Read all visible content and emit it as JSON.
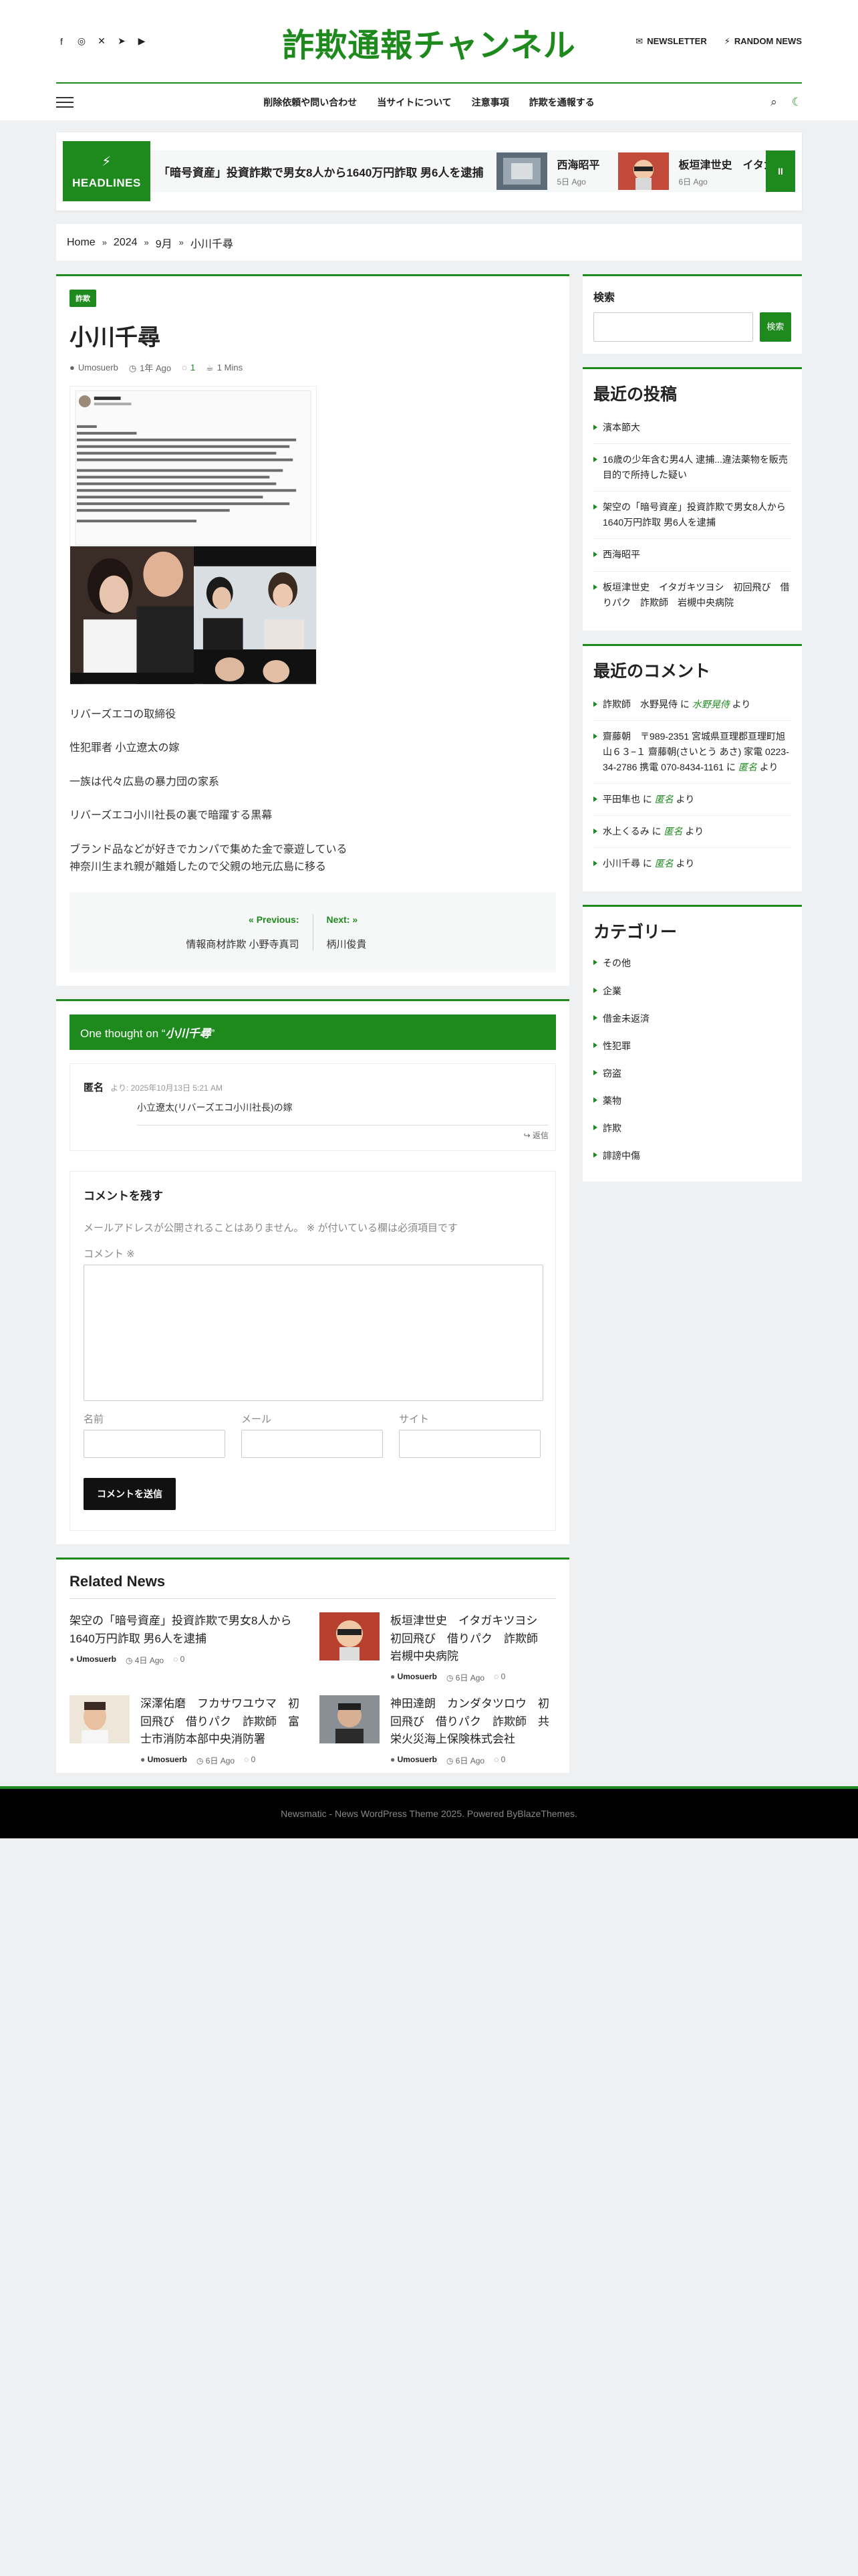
{
  "site": {
    "title": "詐欺通報チャンネル",
    "newsletter": "NEWSLETTER",
    "random": "RANDOM NEWS"
  },
  "menu": [
    "削除依頼や問い合わせ",
    "当サイトについて",
    "注意事項",
    "詐欺を通報する"
  ],
  "ticker": {
    "label": "HEADLINES",
    "lead": "「暗号資産」投資詐欺で男女8人から1640万円詐取 男6人を逮捕",
    "items": [
      {
        "title": "西海昭平",
        "date": "5日 Ago"
      },
      {
        "title": "板垣津世史　イタガ",
        "date": "6日 Ago"
      }
    ],
    "pause": "II"
  },
  "breadcrumb": [
    "Home",
    "2024",
    "9月",
    "小川千尋"
  ],
  "post": {
    "category": "詐欺",
    "title": "小川千尋",
    "author": "Umosuerb",
    "date": "1年 Ago",
    "comments": "1",
    "read": "1 Mins",
    "paragraphs": [
      "リバーズエコの取締役",
      "性犯罪者 小立遼太の嫁",
      "一族は代々広島の暴力団の家系",
      "リバーズエコ小川社長の裏で暗躍する黒幕",
      "ブランド品などが好きでカンパで集めた金で豪遊している\n神奈川生まれ親が離婚したので父親の地元広島に移る"
    ],
    "prev_label": "Previous:",
    "prev_title": "情報商材詐欺 小野寺真司",
    "next_label": "Next:",
    "next_title": "柄川俊貴"
  },
  "comments": {
    "heading_prefix": "One thought on “",
    "heading_title": "小川千尋",
    "heading_suffix": "”",
    "author": "匿名",
    "date": "より: 2025年10月13日 5:21 AM",
    "text": "小立遼太(リバーズエコ小川社長)の嫁",
    "reply": "返信"
  },
  "form": {
    "title": "コメントを残す",
    "note": "メールアドレスが公開されることはありません。 ※ が付いている欄は必須項目です",
    "comment_label": "コメント ※",
    "name_label": "名前",
    "email_label": "メール",
    "site_label": "サイト",
    "submit": "コメントを送信"
  },
  "related": {
    "title": "Related News",
    "items": [
      {
        "title": "架空の「暗号資産」投資詐欺で男女8人から1640万円詐取 男6人を逮捕",
        "author": "Umosuerb",
        "date": "4日 Ago",
        "comments": "0",
        "thumb": false
      },
      {
        "title": "板垣津世史　イタガキツヨシ　初回飛び　借りパク　詐欺師　岩槻中央病院",
        "author": "Umosuerb",
        "date": "6日 Ago",
        "comments": "0",
        "thumb": true
      },
      {
        "title": "深澤佑磨　フカサワユウマ　初回飛び　借りパク　詐欺師　富士市消防本部中央消防署",
        "author": "Umosuerb",
        "date": "6日 Ago",
        "comments": "0",
        "thumb": true
      },
      {
        "title": "神田達朗　カンダタツロウ　初回飛び　借りパク　詐欺師　共栄火災海上保険株式会社",
        "author": "Umosuerb",
        "date": "6日 Ago",
        "comments": "0",
        "thumb": true
      }
    ]
  },
  "sidebar": {
    "search_title": "検索",
    "search_button": "検索",
    "recent_title": "最近の投稿",
    "recent": [
      "濱本節大",
      "16歳の少年含む男4人 逮捕...違法薬物を販売目的で所持した疑い",
      "架空の「暗号資産」投資詐欺で男女8人から1640万円詐取 男6人を逮捕",
      "西海昭平",
      "板垣津世史　イタガキツヨシ　初回飛び　借りパク　詐欺師　岩槻中央病院"
    ],
    "comments_title": "最近のコメント",
    "recent_comments": [
      {
        "author": "詐欺師　水野晃侍",
        "on": " に ",
        "post": "水野晃侍",
        "tail": " より"
      },
      {
        "author": "齋藤朝　〒989-2351 宮城県亘理郡亘理町旭山６３−１ 齋藤朝(さいとう あさ) 家電 0223-34-2786 携電 070-8434-1161",
        "on": " に ",
        "post": "匿名",
        "tail": " より"
      },
      {
        "author": "平田隼也",
        "on": " に ",
        "post": "匿名",
        "tail": " より"
      },
      {
        "author": "水上くるみ",
        "on": " に ",
        "post": "匿名",
        "tail": " より"
      },
      {
        "author": "小川千尋",
        "on": " に ",
        "post": "匿名",
        "tail": " より"
      }
    ],
    "cat_title": "カテゴリー",
    "categories": [
      "その他",
      "企業",
      "借金未返済",
      "性犯罪",
      "窃盗",
      "薬物",
      "詐欺",
      "誹謗中傷"
    ]
  },
  "footer": {
    "text": "Newsmatic - News WordPress Theme 2025. Powered By ",
    "brand": "BlazeThemes."
  },
  "colors": {
    "accent": "#1e8a1e",
    "footer": "#000000"
  }
}
